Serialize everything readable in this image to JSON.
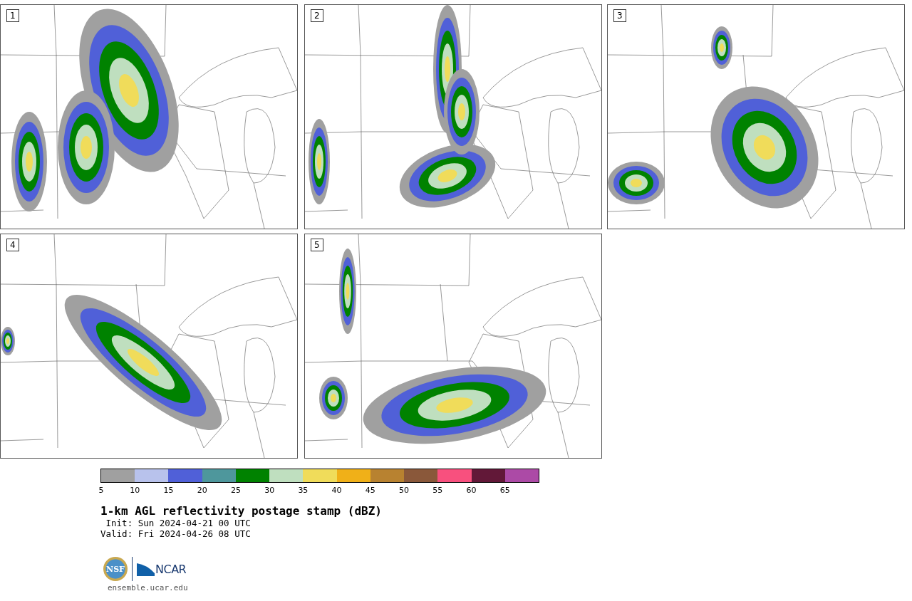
{
  "panels": [
    {
      "label": "1"
    },
    {
      "label": "2"
    },
    {
      "label": "3"
    },
    {
      "label": "4"
    },
    {
      "label": "5"
    }
  ],
  "colorbar": {
    "bins": [
      {
        "color": "#a0a0a0"
      },
      {
        "color": "#b8c2ec"
      },
      {
        "color": "#5060d8"
      },
      {
        "color": "#4e979c"
      },
      {
        "color": "#008200"
      },
      {
        "color": "#bfdfbf"
      },
      {
        "color": "#f0dc5a"
      },
      {
        "color": "#f0b018"
      },
      {
        "color": "#b88230"
      },
      {
        "color": "#8a583a"
      },
      {
        "color": "#f8507e"
      },
      {
        "color": "#621838"
      },
      {
        "color": "#ac4aa6"
      }
    ],
    "ticks": [
      "5",
      "10",
      "15",
      "20",
      "25",
      "30",
      "35",
      "40",
      "45",
      "50",
      "55",
      "60",
      "65"
    ]
  },
  "title": "1-km AGL reflectivity postage stamp (dBZ)",
  "init": " Init: Sun 2024-04-21 00 UTC",
  "valid": "Valid: Fri 2024-04-26 08 UTC",
  "logos": {
    "left": "NSF",
    "right": "NCAR"
  },
  "footer": "ensemble.ucar.edu"
}
